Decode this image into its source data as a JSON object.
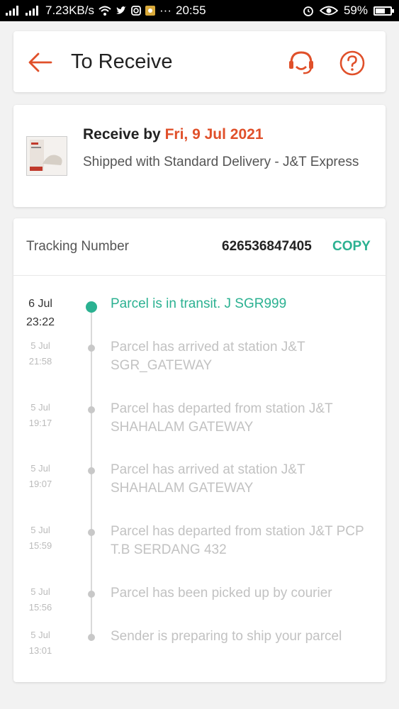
{
  "status_bar": {
    "speed": "7.23KB/s",
    "time": "20:55",
    "battery": "59%",
    "battery_level": 0.59,
    "dots": "···"
  },
  "header": {
    "title": "To Receive",
    "back_icon": "back-arrow-icon",
    "support_icon": "headset-icon",
    "help_icon": "help-icon"
  },
  "delivery": {
    "receive_by_label": "Receive by",
    "receive_date": "Fri, 9 Jul 2021",
    "shipping": "Shipped with Standard Delivery  - J&T Express"
  },
  "tracking": {
    "label": "Tracking Number",
    "number": "626536847405",
    "copy_label": "COPY",
    "events": [
      {
        "date": "6 Jul",
        "time": "23:22",
        "text": "Parcel is in transit. J SGR999",
        "active": true
      },
      {
        "date": "5 Jul",
        "time": "21:58",
        "text": "Parcel has arrived at station J&T SGR_GATEWAY",
        "active": false
      },
      {
        "date": "5 Jul",
        "time": "19:17",
        "text": "Parcel has departed from station J&T SHAHALAM GATEWAY",
        "active": false
      },
      {
        "date": "5 Jul",
        "time": "19:07",
        "text": "Parcel has arrived at station J&T SHAHALAM GATEWAY",
        "active": false
      },
      {
        "date": "5 Jul",
        "time": "15:59",
        "text": "Parcel has departed from station J&T PCP T.B SERDANG 432",
        "active": false
      },
      {
        "date": "5 Jul",
        "time": "15:56",
        "text": "Parcel has been picked up by courier",
        "active": false
      },
      {
        "date": "5 Jul",
        "time": "13:01",
        "text": "Sender is preparing to ship your parcel",
        "active": false
      }
    ]
  },
  "colors": {
    "accent": "#e0502a",
    "green": "#2bb191"
  }
}
